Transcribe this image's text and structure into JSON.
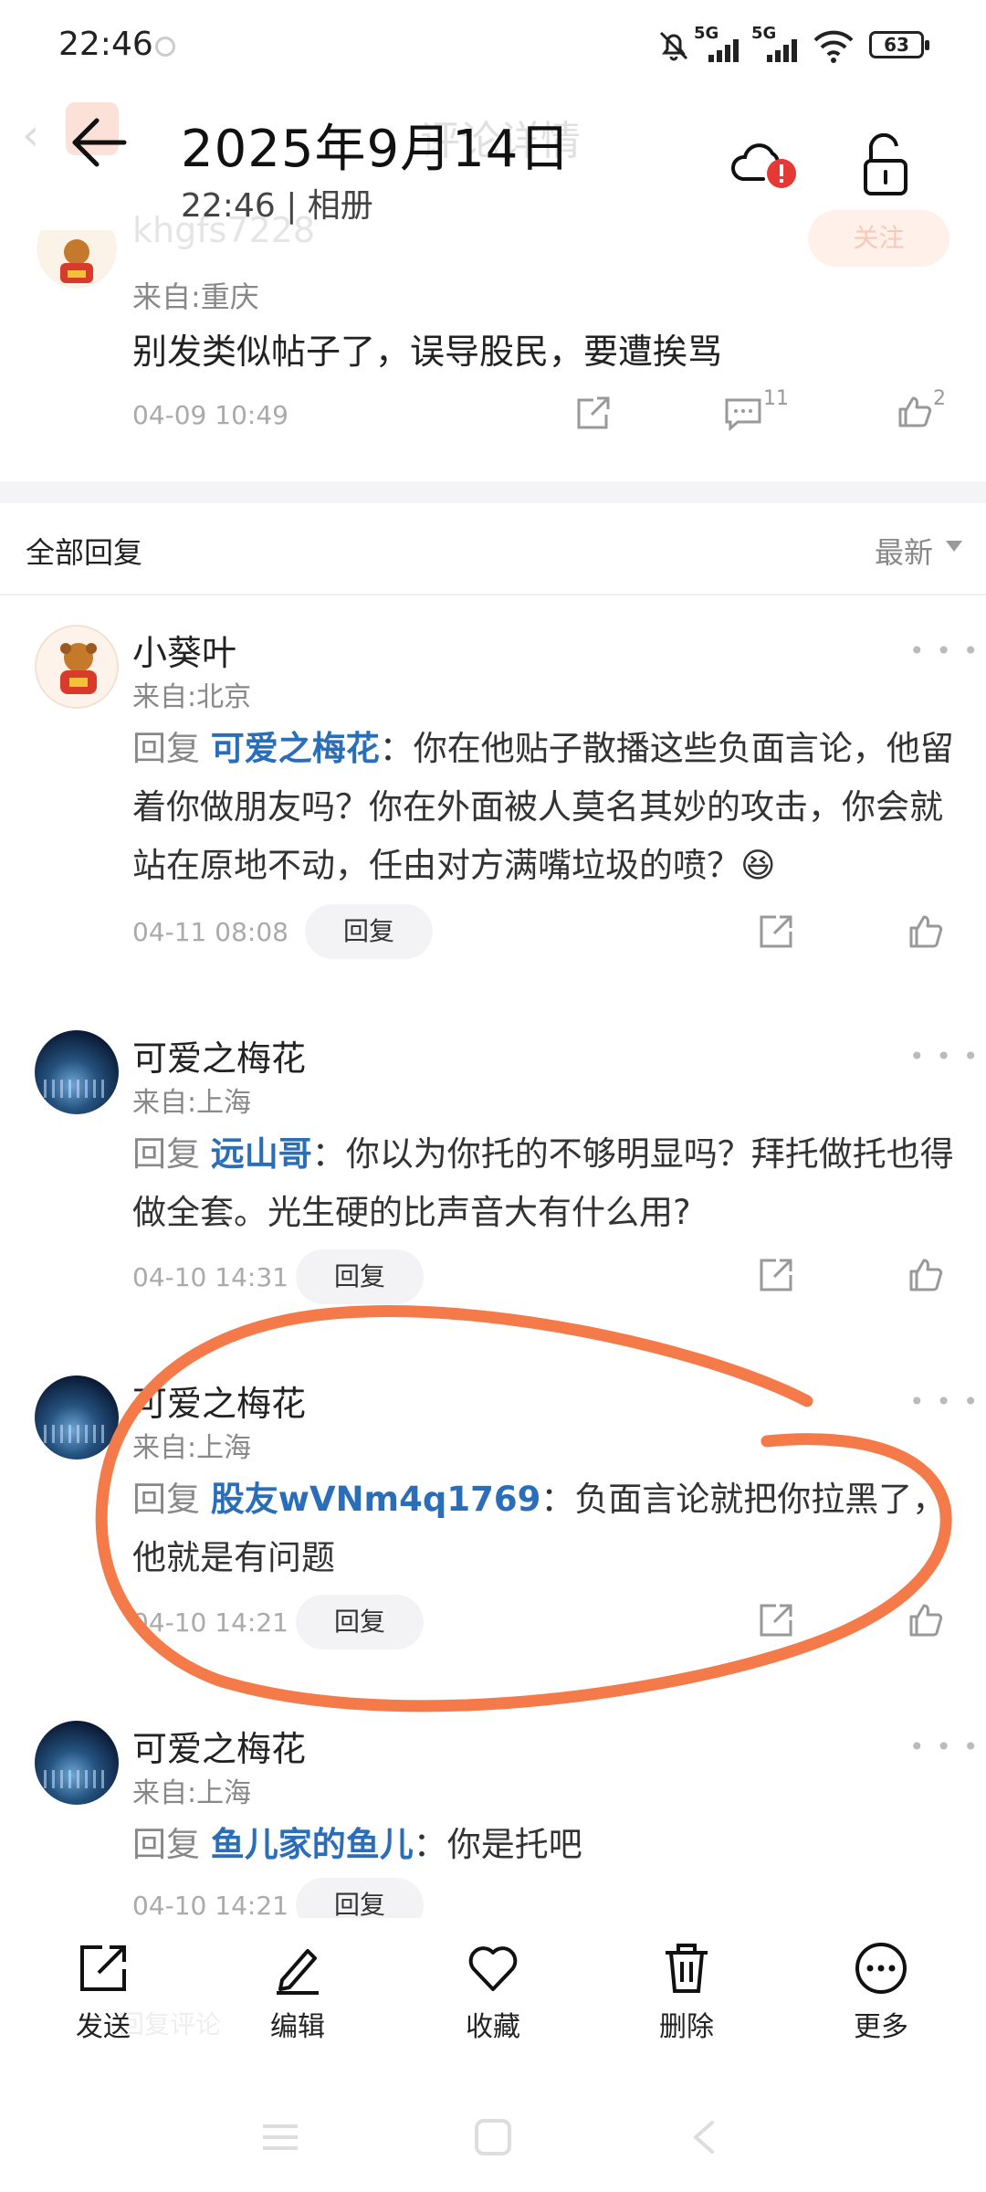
{
  "status_bar": {
    "time": "22:46",
    "net1": "5G",
    "net2": "5G",
    "battery": "63"
  },
  "photo_header": {
    "date": "2025年9月14日",
    "subtitle": "22:46 | 相册"
  },
  "underlying": {
    "title": "评论详情",
    "username": "khgfs7228",
    "follow": "关注",
    "input_hint": "回复评论"
  },
  "post": {
    "from": "来自:重庆",
    "text": "别发类似帖子了，误导股民，要遭挨骂",
    "time": "04-09 10:49",
    "comment_count": "11",
    "like_count": "2"
  },
  "replies_header": {
    "label": "全部回复",
    "sort": "最新"
  },
  "reply_button": "回复",
  "reply_prefix": "回复",
  "comments": [
    {
      "name": "小葵叶",
      "from": "来自:北京",
      "target": "可爱之梅花",
      "text": "：你在他贴子散播这些负面言论，他留着你做朋友吗？你在外面被人莫名其妙的攻击，你会就站在原地不动，任由对方满嘴垃圾的喷？😆",
      "time": "04-11 08:08"
    },
    {
      "name": "可爱之梅花",
      "from": "来自:上海",
      "target": "远山哥",
      "text": "：你以为你托的不够明显吗？拜托做托也得做全套。光生硬的比声音大有什么用?",
      "time": "04-10 14:31"
    },
    {
      "name": "可爱之梅花",
      "from": "来自:上海",
      "target": "股友wVNm4q1769",
      "text": "：负面言论就把你拉黑了，他就是有问题",
      "time": "04-10 14:21"
    },
    {
      "name": "可爱之梅花",
      "from": "来自:上海",
      "target": "鱼儿家的鱼儿",
      "text": "：你是托吧",
      "time": "04-10 14:21"
    }
  ],
  "toolbar": {
    "send": "发送",
    "edit": "编辑",
    "favorite": "收藏",
    "delete": "删除",
    "more": "更多"
  },
  "colors": {
    "accent_link": "#2a6db8",
    "annotation": "#f47a4a"
  }
}
